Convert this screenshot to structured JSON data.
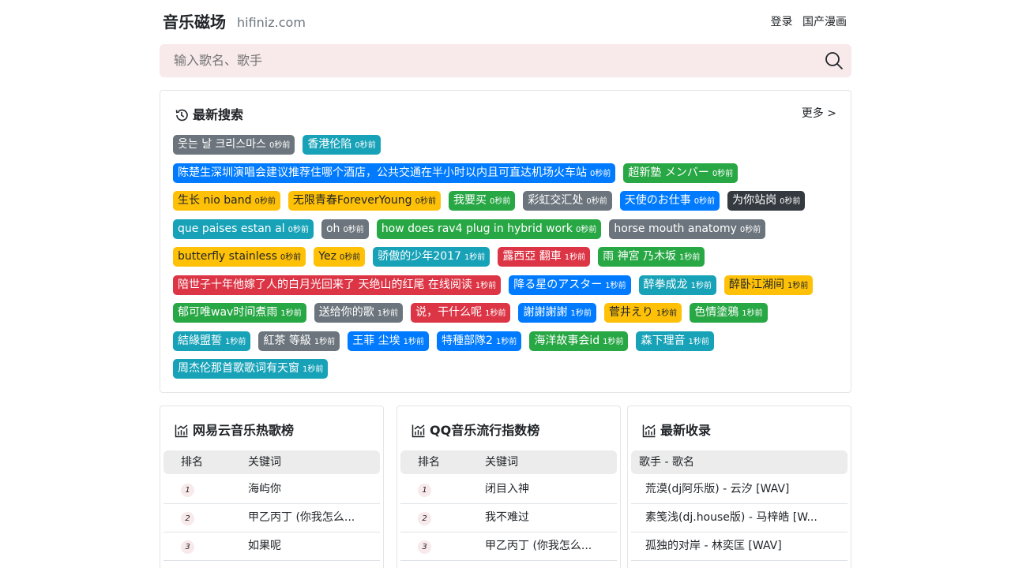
{
  "header": {
    "brand": "音乐磁场",
    "domain": "hifiniz.com",
    "nav": [
      "登录",
      "国产漫画"
    ]
  },
  "search": {
    "placeholder": "输入歌名、歌手"
  },
  "recent": {
    "title": "最新搜索",
    "more": "更多 >",
    "rows": [
      [
        {
          "text": "웃는 날 크리스마스",
          "time": "0秒前",
          "color": "gray"
        },
        {
          "text": "香港伦陷",
          "time": "0秒前",
          "color": "teal"
        }
      ],
      [
        {
          "text": "陈楚生深圳演唱会建议推荐住哪个酒店，公共交通在半小时以内且可直达机场火车站",
          "time": "0秒前",
          "color": "blue"
        },
        {
          "text": "超新塾 メンバー",
          "time": "0秒前",
          "color": "green"
        }
      ],
      [
        {
          "text": "生长 nio band",
          "time": "0秒前",
          "color": "yellow"
        },
        {
          "text": "无限青春ForeverYoung",
          "time": "0秒前",
          "color": "yellow"
        },
        {
          "text": "我要买",
          "time": "0秒前",
          "color": "green"
        },
        {
          "text": "彩虹交汇处",
          "time": "0秒前",
          "color": "gray"
        },
        {
          "text": "天使のお仕事",
          "time": "0秒前",
          "color": "blue"
        },
        {
          "text": "为你站岗",
          "time": "0秒前",
          "color": "dark"
        }
      ],
      [
        {
          "text": "que paises estan al",
          "time": "0秒前",
          "color": "teal"
        },
        {
          "text": "oh",
          "time": "0秒前",
          "color": "gray"
        },
        {
          "text": "how does rav4 plug in hybrid work",
          "time": "0秒前",
          "color": "green"
        },
        {
          "text": "horse mouth anatomy",
          "time": "0秒前",
          "color": "gray"
        }
      ],
      [
        {
          "text": "butterfly stainless",
          "time": "0秒前",
          "color": "yellow"
        },
        {
          "text": "Yez",
          "time": "0秒前",
          "color": "yellow"
        },
        {
          "text": "骄傲的少年2017",
          "time": "1秒前",
          "color": "teal"
        },
        {
          "text": "露西亞 翻車",
          "time": "1秒前",
          "color": "red"
        },
        {
          "text": "雨 神宮 乃木坂",
          "time": "1秒前",
          "color": "green"
        }
      ],
      [
        {
          "text": "陪世子十年他嫁了人的白月光回来了 天绝山的红尾 在线阅读",
          "time": "1秒前",
          "color": "red"
        },
        {
          "text": "降る星のアスター",
          "time": "1秒前",
          "color": "blue"
        },
        {
          "text": "醉拳成龙",
          "time": "1秒前",
          "color": "teal"
        },
        {
          "text": "醉卧江湖间",
          "time": "1秒前",
          "color": "yellow"
        }
      ],
      [
        {
          "text": "郁可唯wav时间煮雨",
          "time": "1秒前",
          "color": "green"
        },
        {
          "text": "送给你的歌",
          "time": "1秒前",
          "color": "gray"
        },
        {
          "text": "说，干什么呢",
          "time": "1秒前",
          "color": "red"
        },
        {
          "text": "謝謝謝謝",
          "time": "1秒前",
          "color": "blue"
        },
        {
          "text": "菅井えり",
          "time": "1秒前",
          "color": "yellow"
        },
        {
          "text": "色情塗鴉",
          "time": "1秒前",
          "color": "green"
        }
      ],
      [
        {
          "text": "結緣盟誓",
          "time": "1秒前",
          "color": "teal"
        },
        {
          "text": "紅茶 等級",
          "time": "1秒前",
          "color": "gray"
        },
        {
          "text": "王菲 尘埃",
          "time": "1秒前",
          "color": "blue"
        },
        {
          "text": "特種部隊2",
          "time": "1秒前",
          "color": "blue"
        },
        {
          "text": "海洋故事会id",
          "time": "1秒前",
          "color": "green"
        },
        {
          "text": "森下理音",
          "time": "1秒前",
          "color": "teal"
        }
      ],
      [
        {
          "text": "周杰伦那首歌歌词有天窗",
          "time": "1秒前",
          "color": "teal"
        }
      ]
    ]
  },
  "netease": {
    "title": "网易云音乐热歌榜",
    "col_rank": "排名",
    "col_keyword": "关键词",
    "rows": [
      {
        "rank": "1",
        "keyword": "海屿你"
      },
      {
        "rank": "2",
        "keyword": "甲乙丙丁 (你我怎么..."
      },
      {
        "rank": "3",
        "keyword": "如果呢"
      }
    ]
  },
  "qq": {
    "title": "QQ音乐流行指数榜",
    "col_rank": "排名",
    "col_keyword": "关键词",
    "rows": [
      {
        "rank": "1",
        "keyword": "闭目入神"
      },
      {
        "rank": "2",
        "keyword": "我不难过"
      },
      {
        "rank": "3",
        "keyword": "甲乙丙丁 (你我怎么..."
      }
    ]
  },
  "latest": {
    "title": "最新收录",
    "col_song": "歌手 - 歌名",
    "rows": [
      {
        "song": "荒漠(dj阿乐版) - 云汐 [WAV]"
      },
      {
        "song": "素笺浅(dj.house版) - 马梓皓 [W..."
      },
      {
        "song": "孤独的对岸 - 林奕匡 [WAV]"
      }
    ]
  }
}
